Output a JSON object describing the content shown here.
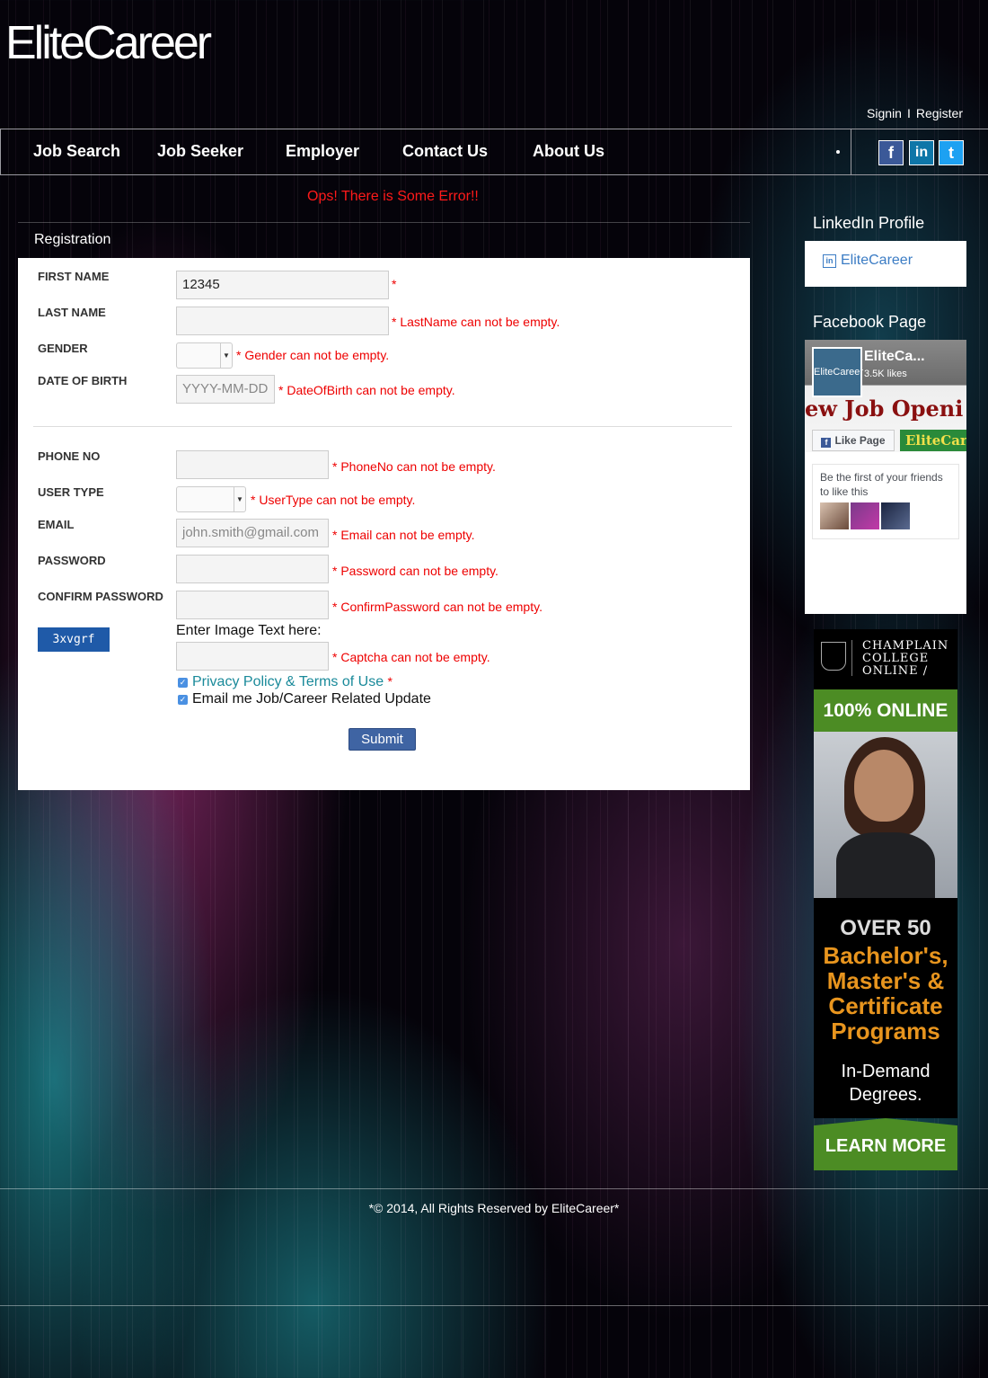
{
  "brand": {
    "logo": "EliteCareer"
  },
  "auth": {
    "signin": "Signin",
    "separator": "I",
    "register": "Register"
  },
  "nav": {
    "items": [
      "Job Search",
      "Job Seeker",
      "Employer",
      "Contact Us",
      "About Us"
    ],
    "social": [
      {
        "icon": "facebook-icon",
        "glyph": "f",
        "color": "#3b5998"
      },
      {
        "icon": "linkedin-icon",
        "glyph": "in",
        "color": "#0e76a8"
      },
      {
        "icon": "twitter-icon",
        "glyph": "t",
        "color": "#1da1f2"
      }
    ]
  },
  "error_banner": "Ops! There is Some Error!!",
  "form": {
    "title": "Registration",
    "first_name": {
      "label": "FIRST NAME",
      "value": "12345",
      "required": "*"
    },
    "last_name": {
      "label": "LAST NAME",
      "value": "",
      "error": "* LastName can not be empty."
    },
    "gender": {
      "label": "GENDER",
      "value": "",
      "error": "* Gender can not be empty."
    },
    "dob": {
      "label": "DATE OF BIRTH",
      "placeholder": "YYYY-MM-DD",
      "error": "* DateOfBirth can not be empty."
    },
    "phone": {
      "label": "PHONE NO",
      "value": "",
      "error": "* PhoneNo can not be empty."
    },
    "user_type": {
      "label": "USER TYPE",
      "value": "",
      "error": "* UserType can not be empty."
    },
    "email": {
      "label": "EMAIL",
      "placeholder": "john.smith@gmail.com",
      "error": "* Email can not be empty."
    },
    "password": {
      "label": "PASSWORD",
      "error": "* Password can not be empty."
    },
    "confirm_password": {
      "label": "CONFIRM PASSWORD",
      "error": "* ConfirmPassword can not be empty."
    },
    "captcha": {
      "image_text": "3xvgrf",
      "label": "Enter Image Text here:",
      "error": "* Captcha can not be empty."
    },
    "privacy": {
      "text": "Privacy Policy & Terms of Use",
      "required": "*",
      "checked": true
    },
    "email_updates": {
      "text": "Email me Job/Career Related Update",
      "checked": true
    },
    "submit_label": "Submit"
  },
  "sidebar": {
    "linkedin_title": "LinkedIn Profile",
    "linkedin_link": "EliteCareer",
    "facebook_title": "Facebook Page",
    "facebook": {
      "name": "EliteCa...",
      "likes": "3.5K likes",
      "logo_text": "EliteCareer",
      "cover_text": "ew Job Openi",
      "like_button": "Like Page",
      "ad_text": "EliteCar",
      "friends_text": "Be the first of your friends to like this"
    }
  },
  "ad": {
    "college": [
      "CHAMPLAIN",
      "COLLEGE",
      "ONLINE /"
    ],
    "online": "100% ONLINE",
    "over": "OVER 50",
    "programs": [
      "Bachelor's,",
      "Master's &",
      "Certificate",
      "Programs"
    ],
    "demand": [
      "In-Demand",
      "Degrees."
    ],
    "cta": "LEARN MORE",
    "colors": {
      "green": "#4c8c24",
      "orange": "#e8951e"
    }
  },
  "footer": {
    "text": "*© 2014, All Rights Reserved by EliteCareer*"
  }
}
